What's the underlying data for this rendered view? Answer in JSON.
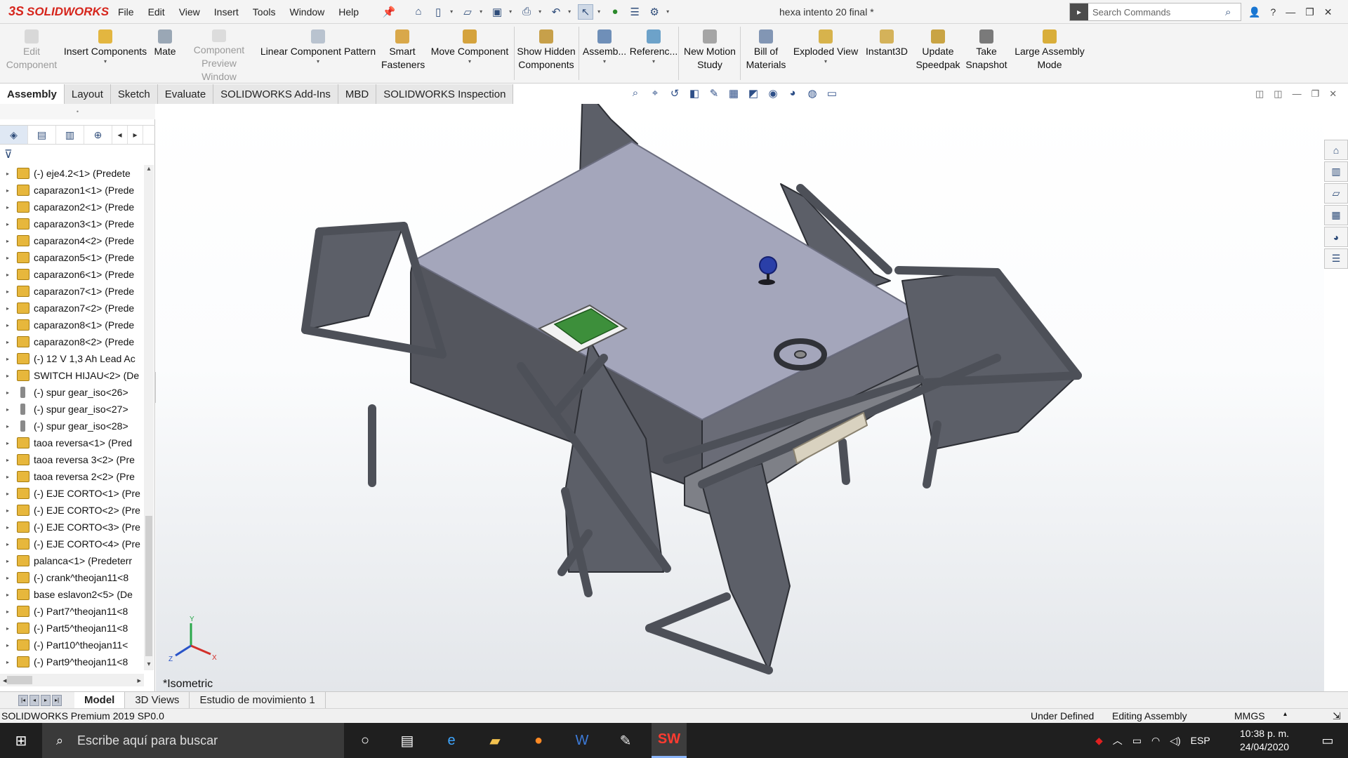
{
  "app": {
    "brand": "SOLIDWORKS",
    "brand_mark": "3S",
    "document_title": "hexa intento 20 final *"
  },
  "menu": [
    "File",
    "Edit",
    "View",
    "Insert",
    "Tools",
    "Window",
    "Help"
  ],
  "quick_access_icons": [
    "pin-icon",
    "home-icon",
    "new-icon",
    "open-icon",
    "save-icon",
    "print-icon",
    "undo-icon",
    "select-icon",
    "rebuild-icon",
    "file-properties-icon",
    "options-icon"
  ],
  "search": {
    "placeholder": "Search Commands"
  },
  "ribbon": {
    "edit_component": "Edit Component",
    "insert_components": "Insert Components",
    "mate": "Mate",
    "component_preview": "Component Preview Window",
    "linear_pattern": "Linear Component Pattern",
    "smart_fasteners": "Smart Fasteners",
    "move_component": "Move Component",
    "show_hidden": "Show Hidden Components",
    "assembly_features": "Assemb...",
    "reference_geometry": "Referenc...",
    "new_motion_study": "New Motion Study",
    "bill_of_materials": "Bill of Materials",
    "exploded_view": "Exploded View",
    "instant3d": "Instant3D",
    "update_speedpak": "Update Speedpak",
    "take_snapshot": "Take Snapshot",
    "large_assembly": "Large Assembly Mode"
  },
  "command_tabs": [
    "Assembly",
    "Layout",
    "Sketch",
    "Evaluate",
    "SOLIDWORKS Add-Ins",
    "MBD",
    "SOLIDWORKS Inspection"
  ],
  "feature_tree": [
    {
      "label": "(-) eje4.2<1> (Predete",
      "type": "asm"
    },
    {
      "label": "caparazon1<1> (Prede",
      "type": "asm"
    },
    {
      "label": "caparazon2<1> (Prede",
      "type": "asm"
    },
    {
      "label": "caparazon3<1> (Prede",
      "type": "asm"
    },
    {
      "label": "caparazon4<2> (Prede",
      "type": "asm"
    },
    {
      "label": "caparazon5<1> (Prede",
      "type": "asm"
    },
    {
      "label": "caparazon6<1> (Prede",
      "type": "asm"
    },
    {
      "label": "caparazon7<1> (Prede",
      "type": "asm"
    },
    {
      "label": "caparazon7<2> (Prede",
      "type": "asm"
    },
    {
      "label": "caparazon8<1> (Prede",
      "type": "asm"
    },
    {
      "label": "caparazon8<2> (Prede",
      "type": "asm"
    },
    {
      "label": "(-) 12 V 1,3 Ah Lead Ac",
      "type": "asm"
    },
    {
      "label": "SWITCH HIJAU<2> (De",
      "type": "asm"
    },
    {
      "label": "(-) spur gear_iso<26>",
      "type": "part"
    },
    {
      "label": "(-) spur gear_iso<27>",
      "type": "part"
    },
    {
      "label": "(-) spur gear_iso<28>",
      "type": "part"
    },
    {
      "label": "taoa reversa<1> (Pred",
      "type": "asm"
    },
    {
      "label": "taoa reversa 3<2> (Pre",
      "type": "asm"
    },
    {
      "label": "taoa reversa 2<2> (Pre",
      "type": "asm"
    },
    {
      "label": "(-) EJE CORTO<1> (Pre",
      "type": "asm"
    },
    {
      "label": "(-) EJE CORTO<2> (Pre",
      "type": "asm"
    },
    {
      "label": "(-) EJE CORTO<3> (Pre",
      "type": "asm"
    },
    {
      "label": "(-) EJE CORTO<4> (Pre",
      "type": "asm"
    },
    {
      "label": "palanca<1> (Predeterr",
      "type": "asm"
    },
    {
      "label": "(-) crank^theojan11<8",
      "type": "asm"
    },
    {
      "label": "base eslavon2<5> (De",
      "type": "asm"
    },
    {
      "label": "(-) Part7^theojan11<8",
      "type": "asm"
    },
    {
      "label": "(-) Part5^theojan11<8",
      "type": "asm"
    },
    {
      "label": "(-) Part10^theojan11<",
      "type": "asm"
    },
    {
      "label": "(-) Part9^theojan11<8",
      "type": "asm"
    }
  ],
  "viewport": {
    "view_name": "*Isometric",
    "triad_x": "X",
    "triad_y": "Y",
    "triad_z": "Z"
  },
  "bottom_tabs": [
    "Model",
    "3D Views",
    "Estudio de movimiento 1"
  ],
  "status": {
    "product": "SOLIDWORKS Premium 2019 SP0.0",
    "definition": "Under Defined",
    "mode": "Editing Assembly",
    "units": "MMGS"
  },
  "taskbar": {
    "search_placeholder": "Escribe aquí para buscar",
    "language": "ESP",
    "time": "10:38 p. m.",
    "date": "24/04/2020",
    "apps": [
      "cortana-icon",
      "task-view-icon",
      "edge-icon",
      "file-explorer-icon",
      "firefox-icon",
      "word-icon",
      "paint-icon",
      "solidworks-icon"
    ]
  },
  "colors": {
    "brand_red": "#d6251c",
    "model_gray": "#5c5f68",
    "box_top": "#a4a6bb",
    "taskbar": "#1f1f1f"
  }
}
